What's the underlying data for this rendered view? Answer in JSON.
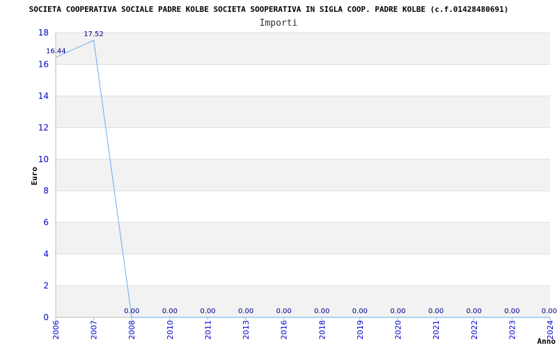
{
  "chart_data": {
    "type": "line",
    "title": "SOCIETA COOPERATIVA SOCIALE PADRE KOLBE SOCIETA SOOPERATIVA IN SIGLA COOP. PADRE KOLBE (c.f.01428480691)",
    "subtitle": "Importi",
    "xlabel": "Anno",
    "ylabel": "Euro",
    "ylim": [
      0,
      18
    ],
    "yticks": [
      "0",
      "2",
      "4",
      "6",
      "8",
      "10",
      "12",
      "14",
      "16",
      "18"
    ],
    "categories": [
      "2006",
      "2007",
      "2008",
      "2010",
      "2011",
      "2013",
      "2016",
      "2018",
      "2019",
      "2020",
      "2021",
      "2022",
      "2023",
      "2024"
    ],
    "series": [
      {
        "values": [
          16.44,
          17.52,
          0,
          0,
          0,
          0,
          0,
          0,
          0,
          0,
          0,
          0,
          0,
          0
        ],
        "labels": [
          "16.44",
          "17.52",
          "0.00",
          "0.00",
          "0.00",
          "0.00",
          "0.00",
          "0.00",
          "0.00",
          "0.00",
          "0.00",
          "0.00",
          "0.00",
          "0.00"
        ],
        "color": "#66aaee"
      }
    ],
    "grid": true,
    "band_color": "#f2f2f2",
    "grid_color": "#dddddd"
  }
}
